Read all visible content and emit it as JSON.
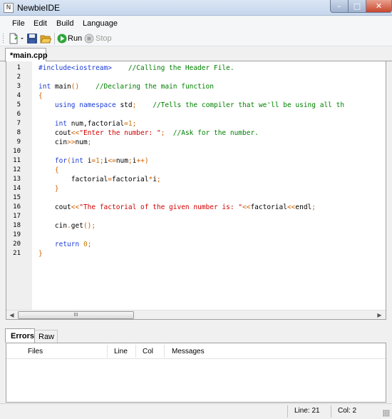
{
  "window": {
    "title": "NewbieIDE",
    "app_icon": "N"
  },
  "menu": [
    "File",
    "Edit",
    "Build",
    "Language"
  ],
  "toolbar": {
    "run_label": "Run",
    "stop_label": "Stop"
  },
  "editor_tab": {
    "label": "*main.cpp"
  },
  "code": {
    "line_numbers": [
      "1",
      "2",
      "3",
      "4",
      "5",
      "6",
      "7",
      "8",
      "9",
      "10",
      "11",
      "12",
      "13",
      "14",
      "15",
      "16",
      "17",
      "18",
      "19",
      "20",
      "21"
    ],
    "lines": [
      [
        {
          "t": "#include<iostream>",
          "c": "pp"
        },
        {
          "t": "    //Calling the Header File.",
          "c": "cm"
        }
      ],
      [],
      [
        {
          "t": "int",
          "c": "k"
        },
        {
          "t": " main",
          "c": "id"
        },
        {
          "t": "()",
          "c": "op"
        },
        {
          "t": "    //Declaring the main function",
          "c": "cm"
        }
      ],
      [
        {
          "t": "{",
          "c": "op"
        }
      ],
      [
        {
          "t": "    ",
          "c": "id"
        },
        {
          "t": "using",
          "c": "k"
        },
        {
          "t": " ",
          "c": "id"
        },
        {
          "t": "namespace",
          "c": "k"
        },
        {
          "t": " std",
          "c": "id"
        },
        {
          "t": ";",
          "c": "op"
        },
        {
          "t": "    //Tells the compiler that we'll be using all th",
          "c": "cm"
        }
      ],
      [],
      [
        {
          "t": "    ",
          "c": "id"
        },
        {
          "t": "int",
          "c": "k"
        },
        {
          "t": " num,factorial",
          "c": "id"
        },
        {
          "t": "=",
          "c": "op"
        },
        {
          "t": "1",
          "c": "num"
        },
        {
          "t": ";",
          "c": "op"
        }
      ],
      [
        {
          "t": "    cout",
          "c": "id"
        },
        {
          "t": "<<",
          "c": "op"
        },
        {
          "t": "\"Enter the number: \"",
          "c": "str"
        },
        {
          "t": ";",
          "c": "op"
        },
        {
          "t": "  //Ask for the number.",
          "c": "cm"
        }
      ],
      [
        {
          "t": "    cin",
          "c": "id"
        },
        {
          "t": ">>",
          "c": "op"
        },
        {
          "t": "num",
          "c": "id"
        },
        {
          "t": ";",
          "c": "op"
        }
      ],
      [],
      [
        {
          "t": "    ",
          "c": "id"
        },
        {
          "t": "for",
          "c": "k"
        },
        {
          "t": "(",
          "c": "op"
        },
        {
          "t": "int",
          "c": "k"
        },
        {
          "t": " i",
          "c": "id"
        },
        {
          "t": "=",
          "c": "op"
        },
        {
          "t": "1",
          "c": "num"
        },
        {
          "t": ";",
          "c": "op"
        },
        {
          "t": "i",
          "c": "id"
        },
        {
          "t": "<=",
          "c": "op"
        },
        {
          "t": "num",
          "c": "id"
        },
        {
          "t": ";",
          "c": "op"
        },
        {
          "t": "i",
          "c": "id"
        },
        {
          "t": "++)",
          "c": "op"
        }
      ],
      [
        {
          "t": "    ",
          "c": "id"
        },
        {
          "t": "{",
          "c": "op"
        }
      ],
      [
        {
          "t": "        factorial",
          "c": "id"
        },
        {
          "t": "=",
          "c": "op"
        },
        {
          "t": "factorial",
          "c": "id"
        },
        {
          "t": "*",
          "c": "op"
        },
        {
          "t": "i",
          "c": "id"
        },
        {
          "t": ";",
          "c": "op"
        }
      ],
      [
        {
          "t": "    ",
          "c": "id"
        },
        {
          "t": "}",
          "c": "op"
        }
      ],
      [],
      [
        {
          "t": "    cout",
          "c": "id"
        },
        {
          "t": "<<",
          "c": "op"
        },
        {
          "t": "\"The factorial of the given number is: \"",
          "c": "str"
        },
        {
          "t": "<<",
          "c": "op"
        },
        {
          "t": "factorial",
          "c": "id"
        },
        {
          "t": "<<",
          "c": "op"
        },
        {
          "t": "endl",
          "c": "id"
        },
        {
          "t": ";",
          "c": "op"
        }
      ],
      [],
      [
        {
          "t": "    cin",
          "c": "id"
        },
        {
          "t": ".",
          "c": "op"
        },
        {
          "t": "get",
          "c": "id"
        },
        {
          "t": "();",
          "c": "op"
        }
      ],
      [],
      [
        {
          "t": "    ",
          "c": "id"
        },
        {
          "t": "return",
          "c": "k"
        },
        {
          "t": " ",
          "c": "id"
        },
        {
          "t": "0",
          "c": "num"
        },
        {
          "t": ";",
          "c": "op"
        }
      ],
      [
        {
          "t": "}",
          "c": "op"
        }
      ]
    ]
  },
  "scrollbar": {
    "thumb_grip": "III"
  },
  "bottom_tabs": {
    "errors_label": "Errors",
    "raw_label": "Raw"
  },
  "errors_table": {
    "col_files": "Files",
    "col_line": "Line",
    "col_col": "Col",
    "col_messages": "Messages"
  },
  "status": {
    "line": "Line: 21",
    "col": "Col: 2"
  }
}
